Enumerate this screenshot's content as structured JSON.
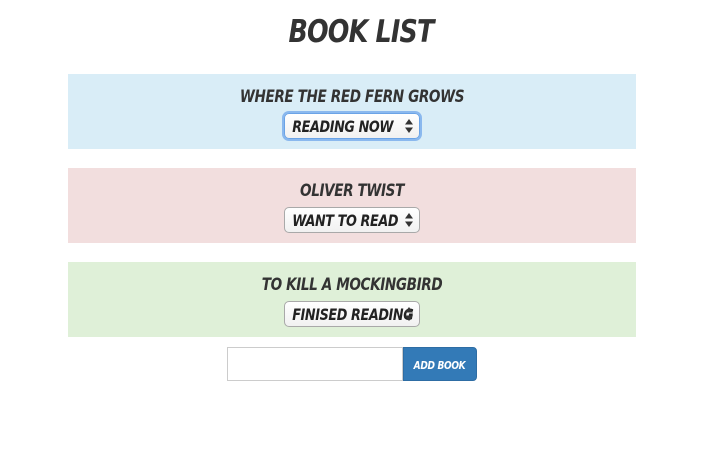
{
  "page": {
    "title": "Book List"
  },
  "books": [
    {
      "title": "Where the Red Fern Grows",
      "status": "Reading Now",
      "background_color": "#d9edf7"
    },
    {
      "title": "Oliver Twist",
      "status": "Want to Read",
      "background_color": "#f2dede"
    },
    {
      "title": "To Kill a Mockingbird",
      "status": "Finised Reading",
      "background_color": "#dff0d8"
    }
  ],
  "add_form": {
    "input_value": "",
    "input_placeholder": "",
    "button_label": "Add Book",
    "button_color": "#337ab7"
  },
  "icons": {
    "select_arrows": "up-down-arrows-icon"
  }
}
